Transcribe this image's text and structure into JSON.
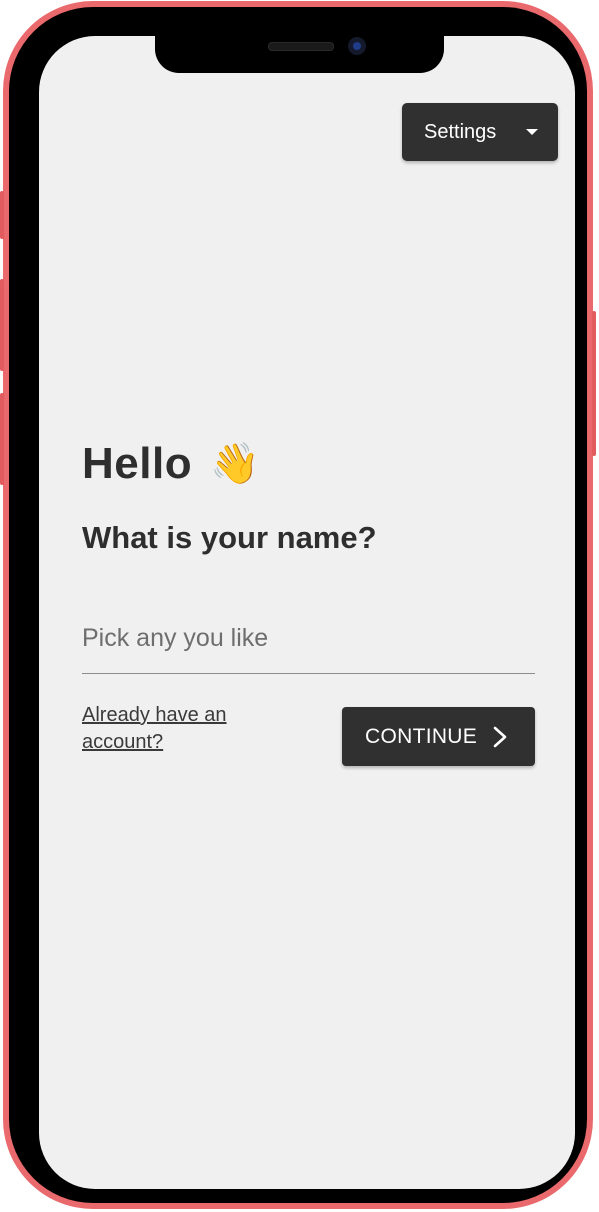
{
  "header": {
    "settings_label": "Settings",
    "settings_icon": "caret-down-icon"
  },
  "greeting": {
    "hello": "Hello",
    "wave_emoji": "👋",
    "question": "What is your name?"
  },
  "name_field": {
    "placeholder": "Pick any you like",
    "value": ""
  },
  "actions": {
    "login_link": "Already have an account?",
    "continue_label": "CONTINUE",
    "continue_icon": "chevron-right-icon"
  },
  "colors": {
    "device_frame": "#e9696c",
    "screen_bg": "#f0f0f0",
    "button_bg": "#303030",
    "button_text": "#ffffff",
    "text_dark": "#2e2e2e"
  }
}
